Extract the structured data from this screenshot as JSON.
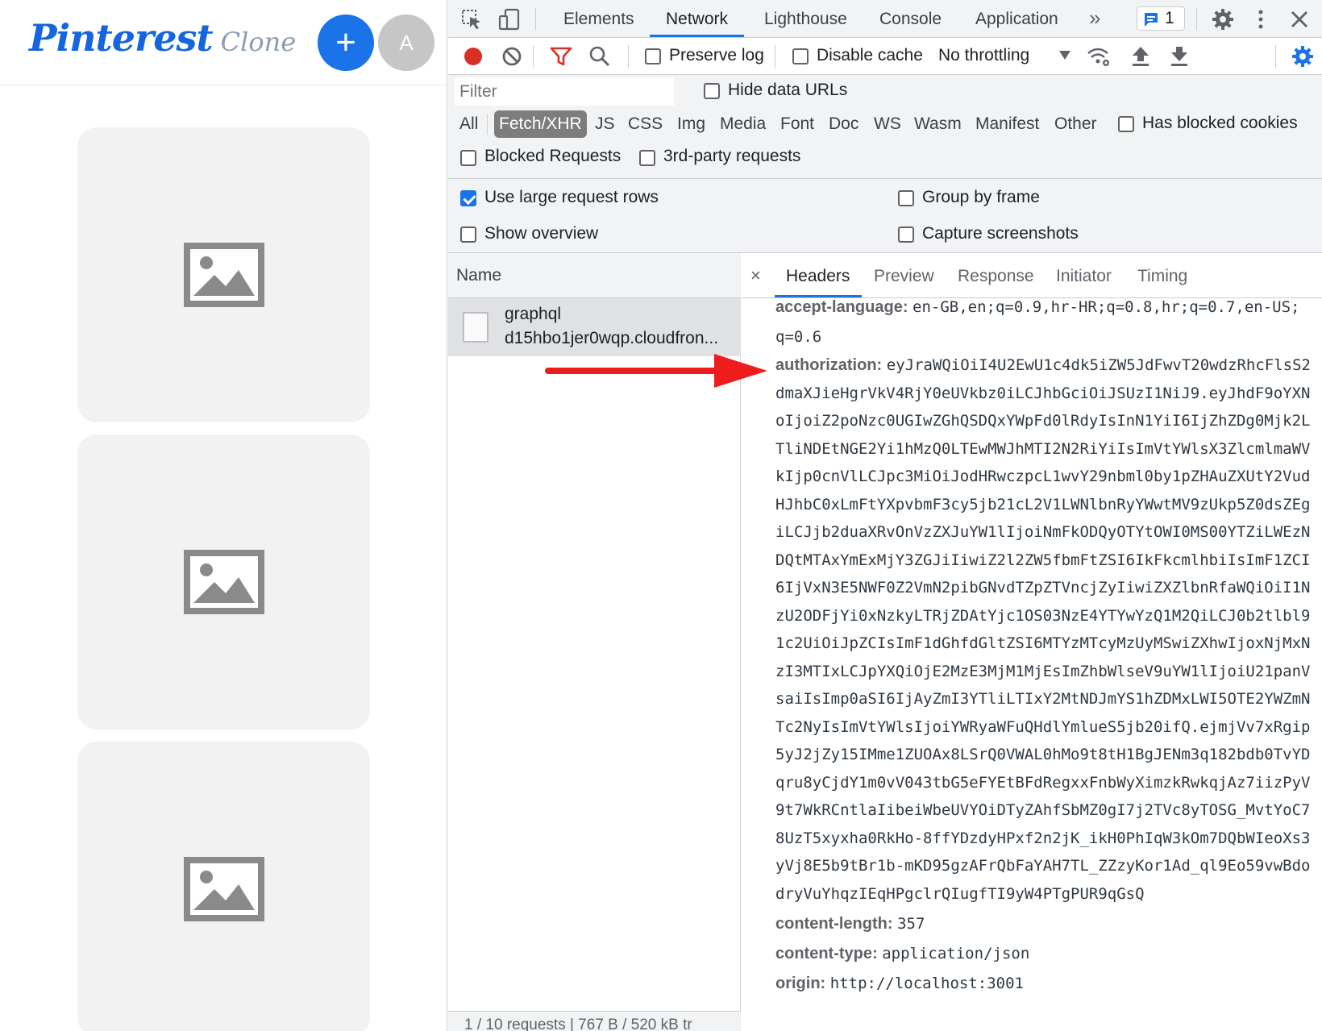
{
  "app": {
    "logo_brand": "Pinterest",
    "logo_sub": "Clone",
    "add_button": "+",
    "avatar_letter": "A",
    "cards": [
      {
        "icon": "image-placeholder-icon"
      },
      {
        "icon": "image-placeholder-icon"
      },
      {
        "icon": "image-placeholder-icon"
      }
    ]
  },
  "devtools": {
    "tabs": [
      "Elements",
      "Network",
      "Lighthouse",
      "Console",
      "Application"
    ],
    "active_tab": "Network",
    "more_tabs": "»",
    "issues_count": "1",
    "toolbar": {
      "preserve_log": "Preserve log",
      "preserve_log_checked": false,
      "disable_cache": "Disable cache",
      "disable_cache_checked": false,
      "throttling": "No throttling"
    },
    "filter": {
      "placeholder": "Filter",
      "hide_data_urls": "Hide data URLs",
      "types": [
        "All",
        "Fetch/XHR",
        "JS",
        "CSS",
        "Img",
        "Media",
        "Font",
        "Doc",
        "WS",
        "Wasm",
        "Manifest",
        "Other"
      ],
      "active_type": "Fetch/XHR",
      "has_blocked_cookies": "Has blocked cookies",
      "blocked_requests": "Blocked Requests",
      "third_party": "3rd-party requests"
    },
    "settings": {
      "large_rows": "Use large request rows",
      "large_rows_checked": true,
      "group_by_frame": "Group by frame",
      "show_overview": "Show overview",
      "capture_screenshots": "Capture screenshots"
    },
    "requests": {
      "header": "Name",
      "items": [
        {
          "name": "graphql",
          "domain": "d15hbo1jer0wqp.cloudfron..."
        }
      ],
      "status": "1 / 10 requests  |  767 B / 520 kB tr"
    },
    "details": {
      "close": "×",
      "tabs": [
        "Headers",
        "Preview",
        "Response",
        "Initiator",
        "Timing"
      ],
      "active_tab": "Headers",
      "headers": [
        {
          "key": "accept-language:",
          "lines": [
            "en-GB,en;q=0.9,hr-HR;q=0.8,hr;q=0.7,en-US;",
            "q=0.6"
          ]
        },
        {
          "key": "authorization:",
          "lines": [
            "eyJraWQiOiI4U2EwU1c4dk5iZW5JdFwvT20wdzRhcFlsS2",
            "dmaXJieHgrVkV4RjY0eUVkbz0iLCJhbGciOiJSUzI1NiJ9.eyJhdF9oYXN",
            "oIjoiZ2poNzc0UGIwZGhQSDQxYWpFd0lRdyIsInN1YiI6IjZhZDg0Mjk2L",
            "TliNDEtNGE2Yi1hMzQ0LTEwMWJhMTI2N2RiYiIsImVtYWlsX3ZlcmlmaWV",
            "kIjp0cnVlLCJpc3MiOiJodHRwczpcL1wvY29nbml0by1pZHAuZXUtY2Vud",
            "HJhbC0xLmFtYXpvbmF3cy5jb21cL2V1LWNlbnRyYWwtMV9zUkp5Z0dsZEg",
            "iLCJjb2duaXRvOnVzZXJuYW1lIjoiNmFkODQyOTYtOWI0MS00YTZiLWEzN",
            "DQtMTAxYmExMjY3ZGJiIiwiZ2l2ZW5fbmFtZSI6IkFkcmlhbiIsImF1ZCI",
            "6IjVxN3E5NWF0Z2VmN2pibGNvdTZpZTVncjZyIiwiZXZlbnRfaWQiOiI1N",
            "zU2ODFjYi0xNzkyLTRjZDAtYjc1OS03NzE4YTYwYzQ1M2QiLCJ0b2tlbl9",
            "1c2UiOiJpZCIsImF1dGhfdGltZSI6MTYzMTcyMzUyMSwiZXhwIjoxNjMxN",
            "zI3MTIxLCJpYXQiOjE2MzE3MjM1MjEsImZhbWlseV9uYW1lIjoiU21panV",
            "saiIsImp0aSI6IjAyZmI3YTliLTIxY2MtNDJmYS1hZDMxLWI5OTE2YWZmN",
            "Tc2NyIsImVtYWlsIjoiYWRyaWFuQHdlYmlueS5jb20ifQ.ejmjVv7xRgip",
            "5yJ2jZy15IMme1ZUOAx8LSrQ0VWAL0hMo9t8tH1BgJENm3q182bdb0TvYD",
            "qru8yCjdY1m0vV043tbG5eFYEtBFdRegxxFnbWyXimzkRwkqjAz7iizPyV",
            "9t7WkRCntlaIibeiWbeUVYOiDTyZAhfSbMZ0gI7j2TVc8yTOSG_MvtYoC7",
            "8UzT5xyxha0RkHo-8ffYDzdyHPxf2n2jK_ikH0PhIqW3kOm7DQbWIeoXs3",
            "yVj8E5b9tBr1b-mKD95gzAFrQbFaYAH7TL_ZZzyKor1Ad_ql9Eo59vwBdo",
            "dryVuYhqzIEqHPgclrQIugfTI9yW4PTgPUR9qGsQ"
          ]
        },
        {
          "key": "content-length:",
          "lines": [
            "357"
          ]
        },
        {
          "key": "content-type:",
          "lines": [
            "application/json"
          ]
        },
        {
          "key": "origin:",
          "lines": [
            "http://localhost:3001"
          ]
        }
      ]
    }
  },
  "colors": {
    "accent": "#1a73e8",
    "record": "#d93025",
    "arrow": "#ee1c1c",
    "logo": "#1565e0"
  }
}
